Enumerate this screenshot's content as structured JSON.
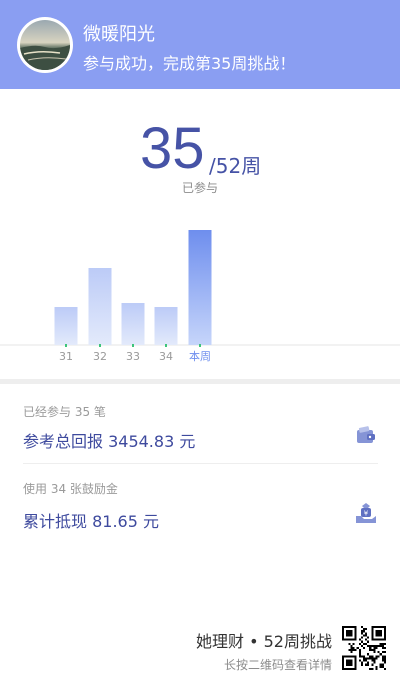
{
  "header": {
    "username": "微暖阳光",
    "message": "参与成功，完成第35周挑战！",
    "bg_color": "#8a9ef2"
  },
  "progress": {
    "current": "35",
    "total": "/52周",
    "caption": "已参与"
  },
  "chart_data": {
    "type": "bar",
    "categories": [
      "31",
      "32",
      "33",
      "34",
      "本周"
    ],
    "values": [
      38,
      77,
      42,
      38,
      115
    ],
    "highlight_index": 4,
    "grid": false,
    "colors": {
      "bar_top": "#bccbf7",
      "bar_bottom": "#dfe7fb",
      "current_top": "#6e8eee",
      "current_bottom": "#c6d5fa",
      "marker": "#3cc47a"
    }
  },
  "stats": [
    {
      "caption": "已经参与 35 笔",
      "value": "参考总回报 3454.83 元",
      "icon": "wallet-icon"
    },
    {
      "caption": "使用 34 张鼓励金",
      "value": "累计抵现 81.65 元",
      "icon": "money-hand-icon"
    }
  ],
  "footer": {
    "brand": "她理财 • 52周挑战",
    "hint": "长按二维码查看详情",
    "qr_icon": "qr-code-icon"
  }
}
